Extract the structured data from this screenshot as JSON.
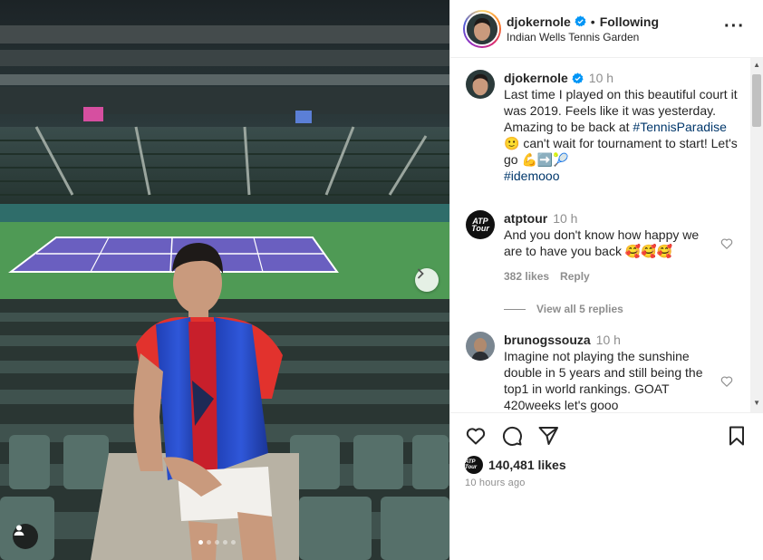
{
  "post": {
    "username": "djokernole",
    "follow_state": "Following",
    "separator": "•",
    "location": "Indian Wells Tennis Garden",
    "more_label": "···"
  },
  "caption": {
    "username": "djokernole",
    "time": "10 h",
    "text_before_tag": "Last time I played on this beautiful court it was 2019. Feels like it was yesterday. Amazing to be back at ",
    "hashtag1": "#TennisParadise",
    "text_after_tag": " 🙂 can't wait for tournament to start! Let's go 💪➡️🎾",
    "hashtag2": "#idemooo"
  },
  "comments": [
    {
      "username": "atptour",
      "time": "10 h",
      "text": "And you don't know how happy we are to have you back 🥰🥰🥰",
      "likes": "382 likes",
      "reply_label": "Reply",
      "avatar_text": "ATP Tour"
    },
    {
      "username": "brunogssouza",
      "time": "10 h",
      "text": "Imagine not playing the sunshine double in 5 years and still being the top1 in world rankings. GOAT 420weeks let's gooo"
    }
  ],
  "view_replies_label": "View all 5 replies",
  "likes": {
    "count_label": "140,481 likes",
    "avatar_text": "ATP Tour"
  },
  "posted_time": "10 hours ago",
  "icons": {
    "like": "heart-icon",
    "comment": "comment-icon",
    "share": "send-icon",
    "save": "bookmark-icon",
    "next": "chevron-right-icon",
    "tag": "user-icon",
    "verified": "verified-badge-icon"
  },
  "colors": {
    "verified_blue": "#0095f6",
    "hashtag": "#00376b",
    "muted": "#8e8e8e",
    "text": "#262626"
  },
  "carousel": {
    "total": 5,
    "active": 1
  }
}
